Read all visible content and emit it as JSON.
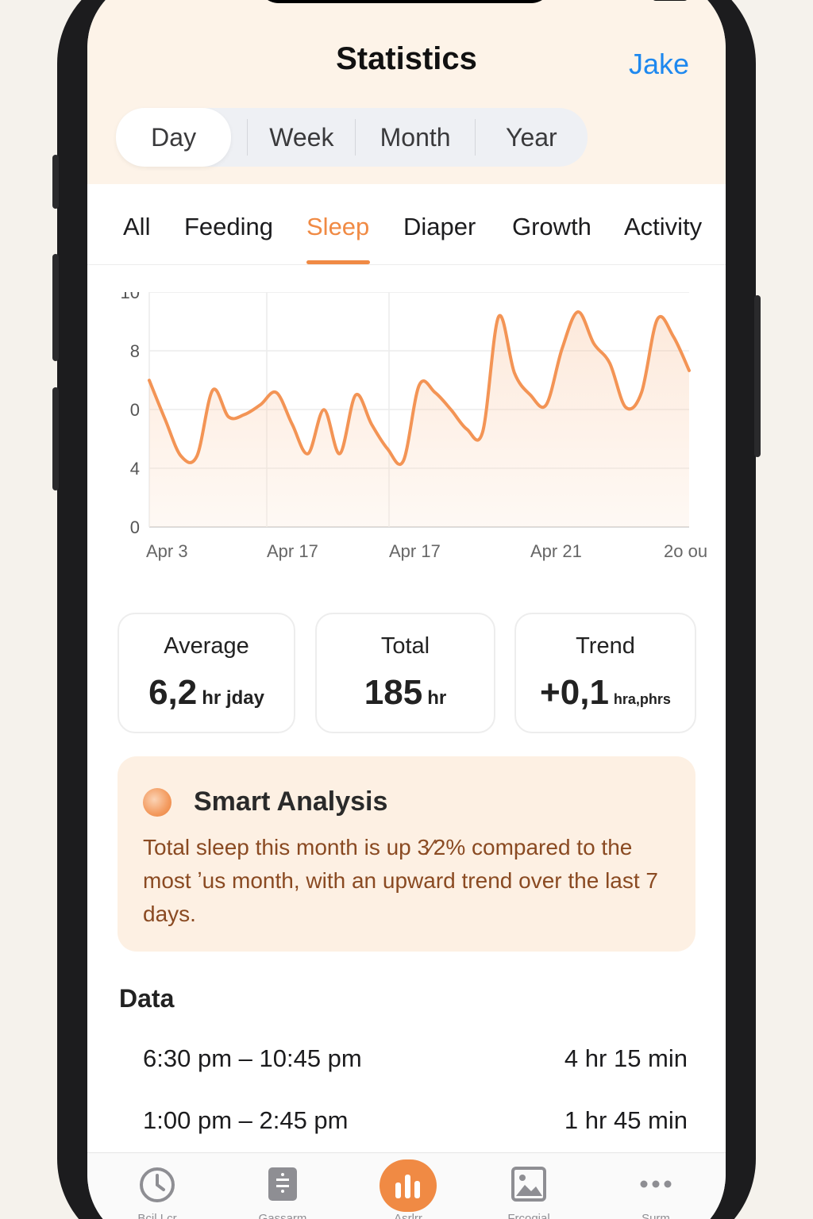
{
  "header": {
    "title": "Statistics",
    "profile_link": "Jake"
  },
  "segments": [
    "Day",
    "Week",
    "Month",
    "Year"
  ],
  "active_segment": "Day",
  "categories": [
    "All",
    "Feeding",
    "Sleep",
    "Diaper",
    "Growth",
    "Activity"
  ],
  "active_category": "Sleep",
  "colors": {
    "accent": "#f08a44",
    "link": "#1e88ef",
    "header_bg": "#fdf3e8",
    "analysis_bg": "#fdf0e3",
    "analysis_text": "#8a4a22"
  },
  "chart_data": {
    "type": "area",
    "y_tick_labels": [
      "10",
      "8",
      "0",
      "4",
      "0"
    ],
    "x_tick_labels": [
      "Apr 3",
      "Apr 17",
      "Apr 17",
      "Apr 21",
      "2o ou"
    ],
    "ylim": [
      0,
      10
    ],
    "grid": true,
    "series": [
      {
        "values": [
          6.0,
          4.4,
          2.9,
          2.9,
          5.6,
          4.5,
          4.6,
          5.0,
          5.5,
          4.2,
          3.0,
          4.8,
          3.0,
          5.4,
          4.2,
          3.2,
          2.7,
          5.8,
          5.5,
          4.8,
          4.0,
          3.9,
          8.6,
          6.3,
          5.4,
          5.0,
          7.3,
          8.8,
          7.5,
          6.7,
          4.9,
          5.5,
          8.5,
          7.8,
          6.4
        ]
      }
    ]
  },
  "stats": [
    {
      "label": "Average",
      "value": "6,2",
      "unit": "hr jday"
    },
    {
      "label": "Total",
      "value": "185",
      "unit": "hr"
    },
    {
      "label": "Trend",
      "value": "+0,1",
      "unit": "hra,phrs"
    }
  ],
  "analysis": {
    "title": "Smart Analysis",
    "body": "Total sleep this month is up 3⁄2% compared to the most ʼus month, with an upward trend over the last 7 days."
  },
  "data_section": {
    "heading": "Data",
    "rows": [
      {
        "range": "6:30 pm – 10:45 pm",
        "duration": "4 hr 15 min"
      },
      {
        "range": "1:00 pm – 2:45 pm",
        "duration": "1 hr 45 min"
      }
    ]
  },
  "tabbar": [
    {
      "label": "Bcil Lcr",
      "icon": "clock-icon"
    },
    {
      "label": "Gassarm",
      "icon": "calculator-icon"
    },
    {
      "label": "Asrlrr",
      "icon": "bar-chart-icon"
    },
    {
      "label": "Frcoqial",
      "icon": "image-icon"
    },
    {
      "label": "Surm",
      "icon": "more-icon"
    }
  ]
}
